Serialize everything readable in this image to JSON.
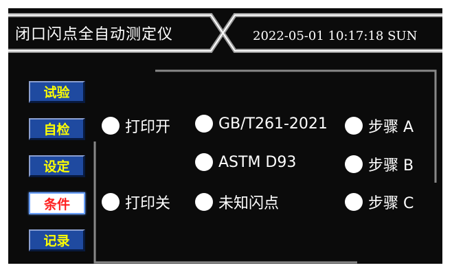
{
  "header": {
    "title": "闭口闪点全自动测定仪",
    "datetime": "2022-05-01  10:17:18 SUN"
  },
  "nav": [
    {
      "label": "试验",
      "active": false
    },
    {
      "label": "自检",
      "active": false
    },
    {
      "label": "设定",
      "active": false
    },
    {
      "label": "条件",
      "active": true
    },
    {
      "label": "记录",
      "active": false
    }
  ],
  "print": {
    "on": "打印开",
    "off": "打印关"
  },
  "standards": {
    "gb": "GB/T261-2021",
    "astm": "ASTM D93",
    "unknown": "未知闪点"
  },
  "steps": {
    "a": "步骤 A",
    "b": "步骤 B",
    "c": "步骤 C"
  },
  "colors": {
    "nav_bg": "#1f4aa0",
    "nav_text": "#ffff00",
    "active_text": "#ff2020",
    "background": "#0b0b0b"
  }
}
